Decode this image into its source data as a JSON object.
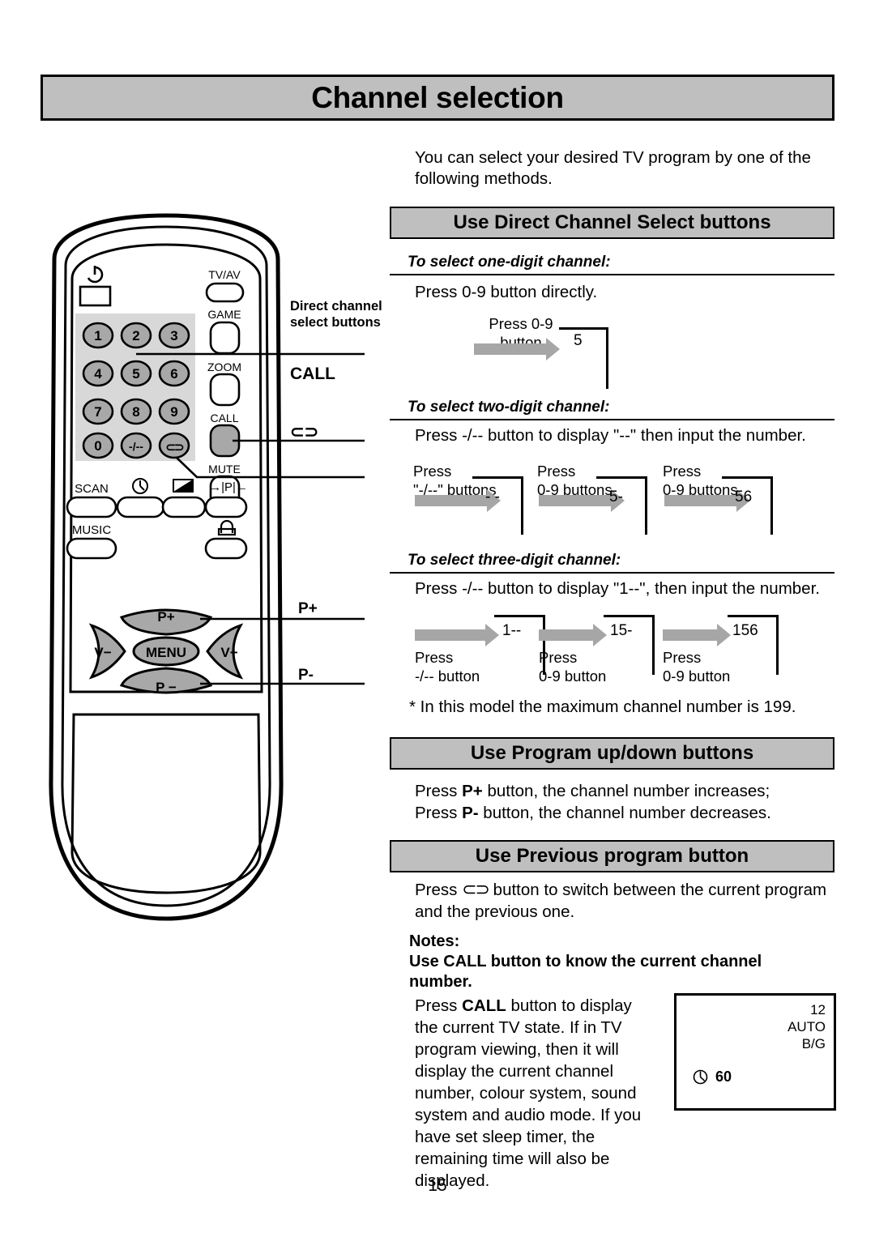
{
  "page": {
    "title": "Channel selection",
    "number": "15",
    "intro": "You can select your desired TV program by one of the following methods."
  },
  "sections": {
    "direct": {
      "heading": "Use Direct Channel Select buttons",
      "one_digit": {
        "subhead": "To select one-digit channel:",
        "text": "Press 0-9 button directly.",
        "steps": [
          {
            "label_line1": "Press 0-9",
            "label_line2": "button",
            "display": "5"
          }
        ]
      },
      "two_digit": {
        "subhead": "To select two-digit channel:",
        "text": "Press -/-- button to display \"--\" then input the number.",
        "steps": [
          {
            "label_line1": "Press",
            "label_line2": "\"-/--\" buttons",
            "display": "- -"
          },
          {
            "label_line1": "Press",
            "label_line2": "0-9 buttons",
            "display": "5-"
          },
          {
            "label_line1": "Press",
            "label_line2": "0-9 buttons",
            "display": "56"
          }
        ]
      },
      "three_digit": {
        "subhead": "To select three-digit channel:",
        "text": "Press -/-- button to display \"1--\", then input the number.",
        "steps": [
          {
            "label_line1": "Press",
            "label_line2": "-/-- button",
            "display": "1--"
          },
          {
            "label_line1": "Press",
            "label_line2": "0-9 button",
            "display": "15-"
          },
          {
            "label_line1": "Press",
            "label_line2": "0-9 button",
            "display": "156"
          }
        ]
      },
      "footnote": "* In this model the maximum channel number is 199."
    },
    "program_updown": {
      "heading": "Use Program up/down buttons",
      "line1_pre": "Press ",
      "line1_key": "P+",
      "line1_post": " button, the channel number increases;",
      "line2_pre": "Press ",
      "line2_key": "P-",
      "line2_post": " button, the channel number decreases."
    },
    "previous": {
      "heading": "Use Previous program button",
      "text_pre": "Press ",
      "glyph": "⊂⊃",
      "text_post": " button to switch between the current program and the previous one."
    },
    "notes": {
      "label": "Notes:",
      "headline": "Use CALL button to know the current channel number.",
      "body_pre": "Press ",
      "body_key": "CALL",
      "body_post": " button to display the current TV state. If in TV program viewing, then it will display the current channel number, colour system, sound system and audio mode. If you have set sleep timer, the remaining time will also be displayed."
    }
  },
  "tv_display": {
    "channel": "12",
    "colour_system": "AUTO",
    "sound_system": "B/G",
    "timer_icon": "clock-icon",
    "timer_value": "60"
  },
  "remote": {
    "power_icon": "power-icon",
    "keypad": [
      [
        "1",
        "2",
        "3"
      ],
      [
        "4",
        "5",
        "6"
      ],
      [
        "7",
        "8",
        "9"
      ],
      [
        "0",
        "-/--",
        "⊂⊃"
      ]
    ],
    "side_buttons": [
      {
        "label": "TV/AV",
        "shaded": false
      },
      {
        "label": "GAME",
        "shaded": false
      },
      {
        "label": "ZOOM",
        "shaded": false
      },
      {
        "label": "CALL",
        "shaded": true
      },
      {
        "label": "MUTE",
        "shaded": false
      }
    ],
    "feature_row_1": [
      {
        "label": "SCAN",
        "icon": ""
      },
      {
        "label": "",
        "icon": "clock-icon"
      },
      {
        "label": "",
        "icon": "contrast-icon"
      },
      {
        "label": "→|P|←",
        "icon": ""
      }
    ],
    "feature_row_2": [
      {
        "label": "MUSIC",
        "icon": ""
      },
      {
        "label": "",
        "icon": "lock-icon"
      }
    ],
    "navpad": {
      "up": "P+",
      "left": "V−",
      "center": "MENU",
      "right": "V+",
      "down": "P −"
    }
  },
  "callouts": {
    "direct_line1": "Direct channel",
    "direct_line2": "select buttons",
    "call": "CALL",
    "previous_glyph": "⊂⊃",
    "p_plus": "P+",
    "p_minus": "P-"
  },
  "colors": {
    "band": "#bfbfbf",
    "arrow": "#a6a6a6",
    "keypad_panel": "#d8d8d8",
    "key_fill": "#a8a8a8"
  }
}
